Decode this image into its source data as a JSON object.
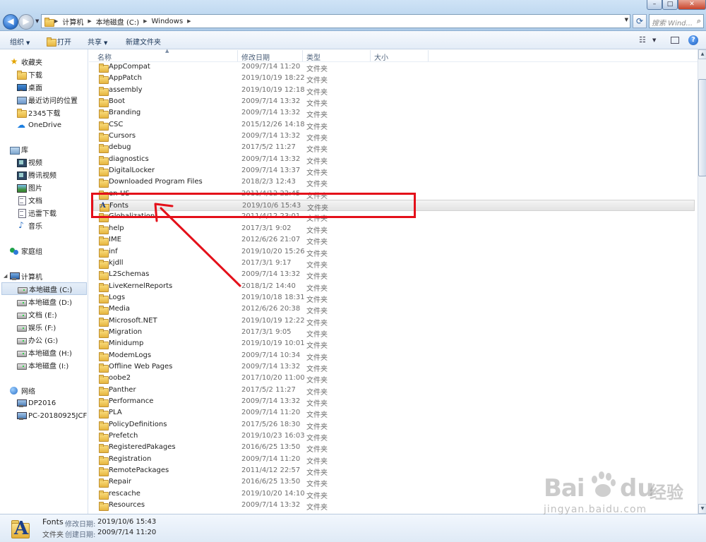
{
  "address": {
    "crumbs": [
      "计算机",
      "本地磁盘 (C:)",
      "Windows"
    ],
    "search_placeholder": "搜索 Wind..."
  },
  "toolbar": {
    "organize": "组织",
    "open": "打开",
    "share": "共享",
    "new_folder": "新建文件夹"
  },
  "sidebar": {
    "favorites": {
      "label": "收藏夹",
      "items": [
        "下载",
        "桌面",
        "最近访问的位置",
        "2345下载",
        "OneDrive"
      ]
    },
    "libraries": {
      "label": "库",
      "items": [
        "视频",
        "腾讯视频",
        "图片",
        "文档",
        "迅雷下载",
        "音乐"
      ]
    },
    "homegroup": {
      "label": "家庭组"
    },
    "computer": {
      "label": "计算机",
      "items": [
        "本地磁盘 (C:)",
        "本地磁盘 (D:)",
        "文档 (E:)",
        "娱乐 (F:)",
        "办公 (G:)",
        "本地磁盘 (H:)",
        "本地磁盘 (I:)"
      ]
    },
    "network": {
      "label": "网络",
      "items": [
        "DP2016",
        "PC-20180925JCFL"
      ]
    }
  },
  "columns": {
    "name": "名称",
    "modified": "修改日期",
    "type": "类型",
    "size": "大小"
  },
  "files": [
    {
      "name": "AppCompat",
      "date": "2009/7/14 11:20",
      "type": "文件夹"
    },
    {
      "name": "AppPatch",
      "date": "2019/10/19 18:22",
      "type": "文件夹"
    },
    {
      "name": "assembly",
      "date": "2019/10/19 12:18",
      "type": "文件夹"
    },
    {
      "name": "Boot",
      "date": "2009/7/14 13:32",
      "type": "文件夹"
    },
    {
      "name": "Branding",
      "date": "2009/7/14 13:32",
      "type": "文件夹"
    },
    {
      "name": "CSC",
      "date": "2015/12/26 14:18",
      "type": "文件夹"
    },
    {
      "name": "Cursors",
      "date": "2009/7/14 13:32",
      "type": "文件夹"
    },
    {
      "name": "debug",
      "date": "2017/5/2 11:27",
      "type": "文件夹"
    },
    {
      "name": "diagnostics",
      "date": "2009/7/14 13:32",
      "type": "文件夹"
    },
    {
      "name": "DigitalLocker",
      "date": "2009/7/14 13:37",
      "type": "文件夹"
    },
    {
      "name": "Downloaded Program Files",
      "date": "2018/2/3 12:43",
      "type": "文件夹"
    },
    {
      "name": "en-US",
      "date": "2011/4/12 22:45",
      "type": "文件夹"
    },
    {
      "name": "Fonts",
      "date": "2019/10/6 15:43",
      "type": "文件夹"
    },
    {
      "name": "Globalization",
      "date": "2011/4/12 23:01",
      "type": "文件夹"
    },
    {
      "name": "help",
      "date": "2017/3/1 9:02",
      "type": "文件夹"
    },
    {
      "name": "IME",
      "date": "2012/6/26 21:07",
      "type": "文件夹"
    },
    {
      "name": "inf",
      "date": "2019/10/20 15:26",
      "type": "文件夹"
    },
    {
      "name": "kjdll",
      "date": "2017/3/1 9:17",
      "type": "文件夹"
    },
    {
      "name": "L2Schemas",
      "date": "2009/7/14 13:32",
      "type": "文件夹"
    },
    {
      "name": "LiveKernelReports",
      "date": "2018/1/2 14:40",
      "type": "文件夹"
    },
    {
      "name": "Logs",
      "date": "2019/10/18 18:31",
      "type": "文件夹"
    },
    {
      "name": "Media",
      "date": "2012/6/26 20:38",
      "type": "文件夹"
    },
    {
      "name": "Microsoft.NET",
      "date": "2019/10/19 12:22",
      "type": "文件夹"
    },
    {
      "name": "Migration",
      "date": "2017/3/1 9:05",
      "type": "文件夹"
    },
    {
      "name": "Minidump",
      "date": "2019/10/19 10:01",
      "type": "文件夹"
    },
    {
      "name": "ModemLogs",
      "date": "2009/7/14 10:34",
      "type": "文件夹"
    },
    {
      "name": "Offline Web Pages",
      "date": "2009/7/14 13:32",
      "type": "文件夹"
    },
    {
      "name": "oobe2",
      "date": "2017/10/20 11:00",
      "type": "文件夹"
    },
    {
      "name": "Panther",
      "date": "2017/5/2 11:27",
      "type": "文件夹"
    },
    {
      "name": "Performance",
      "date": "2009/7/14 13:32",
      "type": "文件夹"
    },
    {
      "name": "PLA",
      "date": "2009/7/14 11:20",
      "type": "文件夹"
    },
    {
      "name": "PolicyDefinitions",
      "date": "2017/5/26 18:30",
      "type": "文件夹"
    },
    {
      "name": "Prefetch",
      "date": "2019/10/23 16:03",
      "type": "文件夹"
    },
    {
      "name": "RegisteredPakages",
      "date": "2016/6/25 13:50",
      "type": "文件夹"
    },
    {
      "name": "Registration",
      "date": "2009/7/14 11:20",
      "type": "文件夹"
    },
    {
      "name": "RemotePackages",
      "date": "2011/4/12 22:57",
      "type": "文件夹"
    },
    {
      "name": "Repair",
      "date": "2016/6/25 13:50",
      "type": "文件夹"
    },
    {
      "name": "rescache",
      "date": "2019/10/20 14:10",
      "type": "文件夹"
    },
    {
      "name": "Resources",
      "date": "2009/7/14 13:32",
      "type": "文件夹"
    }
  ],
  "selected_file": "Fonts",
  "details": {
    "name": "Fonts",
    "type": "文件夹",
    "modified_label": "修改日期:",
    "modified": "2019/10/6 15:43",
    "created_label": "创建日期:",
    "created": "2009/7/14 11:20"
  },
  "watermark": {
    "brand_left": "Bai",
    "brand_right": "du",
    "brand_cn": "经验",
    "url": "jingyan.baidu.com"
  },
  "colors": {
    "annotation": "#e4101a",
    "selected_row": "#e3e3e3",
    "folder": "#e6b640"
  }
}
